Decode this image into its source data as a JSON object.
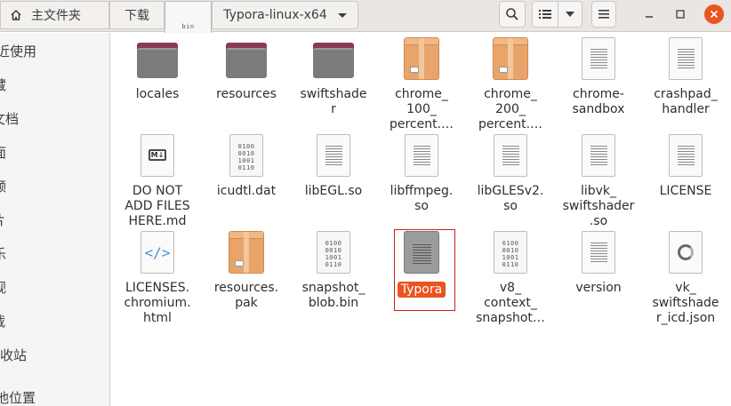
{
  "header": {
    "breadcrumbs": [
      {
        "label": "主文件夹",
        "icon": "home-icon"
      },
      {
        "label": "下载"
      },
      {
        "label": "bin"
      },
      {
        "label": "Typora-linux-x64"
      }
    ],
    "buttons": {
      "search_icon": "search-icon",
      "view_icon": "list-view-icon",
      "view_dropdown_icon": "chevron-down-icon",
      "menu_icon": "hamburger-menu-icon"
    },
    "window_controls": {
      "minimize": "minimize-icon",
      "maximize": "maximize-icon",
      "close": "close-icon"
    },
    "accent_color": "#e95420"
  },
  "sidebar": {
    "items": [
      {
        "label": "近使用"
      },
      {
        "label": "藏"
      },
      {
        "label": "文档"
      },
      {
        "label": "面"
      },
      {
        "label": "频"
      },
      {
        "label": "片"
      },
      {
        "label": "乐"
      },
      {
        "label": "视"
      },
      {
        "label": "载"
      },
      {
        "label": "回收站"
      },
      {
        "label": "他位置"
      }
    ]
  },
  "files": [
    {
      "name": "locales",
      "type": "folder"
    },
    {
      "name": "resources",
      "type": "folder"
    },
    {
      "name": "swiftshade\nr",
      "type": "folder"
    },
    {
      "name": "chrome_\n100_\npercent.…",
      "type": "package"
    },
    {
      "name": "chrome_\n200_\npercent.…",
      "type": "package"
    },
    {
      "name": "chrome-\nsandbox",
      "type": "doc"
    },
    {
      "name": "crashpad_\nhandler",
      "type": "doc"
    },
    {
      "name": "DO NOT\nADD FILES\nHERE.md",
      "type": "markdown"
    },
    {
      "name": "icudtl.dat",
      "type": "binary"
    },
    {
      "name": "libEGL.so",
      "type": "doc"
    },
    {
      "name": "libffmpeg.\nso",
      "type": "doc"
    },
    {
      "name": "libGLESv2.\nso",
      "type": "doc"
    },
    {
      "name": "libvk_\nswiftshader\n.so",
      "type": "doc"
    },
    {
      "name": "LICENSE",
      "type": "doc"
    },
    {
      "name": "LICENSES.\nchromium.\nhtml",
      "type": "html"
    },
    {
      "name": "resources.\npak",
      "type": "package"
    },
    {
      "name": "snapshot_\nblob.bin",
      "type": "binary"
    },
    {
      "name": "Typora",
      "type": "executable",
      "selected": true
    },
    {
      "name": "v8_\ncontext_\nsnapshot…",
      "type": "binary"
    },
    {
      "name": "version",
      "type": "doc"
    },
    {
      "name": "vk_\nswiftshade\nr_icd.json",
      "type": "json"
    }
  ],
  "binary_glyph": "0100\n0010\n1001\n0110"
}
